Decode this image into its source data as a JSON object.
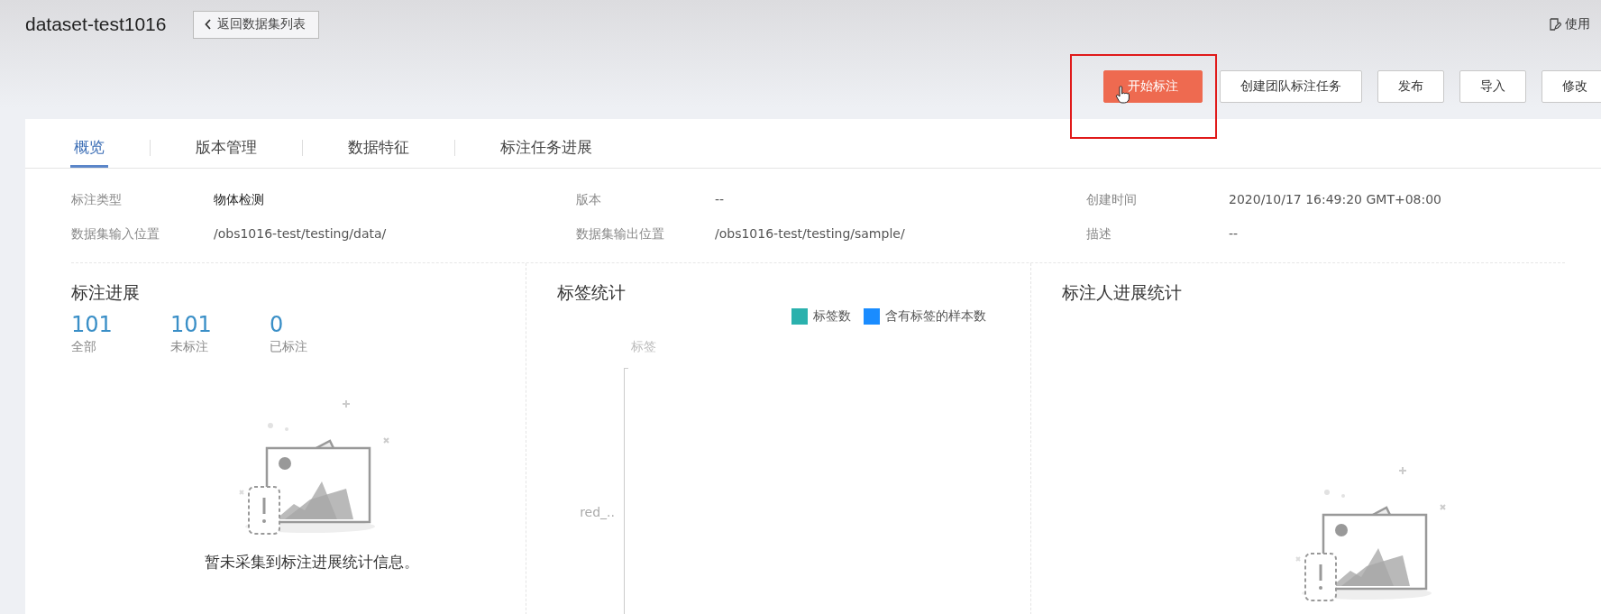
{
  "header": {
    "title": "dataset-test1016",
    "back_button": "返回数据集列表",
    "help_link": "使用"
  },
  "actions": [
    {
      "label": "开始标注",
      "kind": "primary",
      "highlighted": true
    },
    {
      "label": "创建团队标注任务",
      "kind": "default",
      "highlighted": false
    },
    {
      "label": "发布",
      "kind": "default",
      "highlighted": false
    },
    {
      "label": "导入",
      "kind": "default",
      "highlighted": false
    },
    {
      "label": "修改",
      "kind": "default",
      "highlighted": false
    }
  ],
  "tabs": [
    {
      "label": "概览",
      "selected": true
    },
    {
      "label": "版本管理",
      "selected": false
    },
    {
      "label": "数据特征",
      "selected": false
    },
    {
      "label": "标注任务进展",
      "selected": false
    }
  ],
  "info": [
    {
      "label": "标注类型",
      "value": "物体检测",
      "strong": true
    },
    {
      "label": "版本",
      "value": "--",
      "strong": false
    },
    {
      "label": "创建时间",
      "value": "2020/10/17 16:49:20 GMT+08:00",
      "strong": false
    },
    {
      "label": "数据集输入位置",
      "value": "/obs1016-test/testing/data/",
      "strong": false
    },
    {
      "label": "数据集输出位置",
      "value": "/obs1016-test/testing/sample/",
      "strong": false
    },
    {
      "label": "描述",
      "value": "--",
      "strong": false
    }
  ],
  "progress": {
    "title": "标注进展",
    "stats": [
      {
        "value": "101",
        "label": "全部"
      },
      {
        "value": "101",
        "label": "未标注"
      },
      {
        "value": "0",
        "label": "已标注"
      }
    ],
    "empty_message": "暂未采集到标注进展统计信息。"
  },
  "label_stats": {
    "title": "标签统计",
    "legend": [
      {
        "name": "标签数",
        "color": "#2bb1ad"
      },
      {
        "name": "含有标签的样本数",
        "color": "#1a8cff"
      }
    ],
    "axis_label": "标签",
    "category_labels": [
      "red_.."
    ]
  },
  "annotator_stats": {
    "title": "标注人进展统计"
  }
}
